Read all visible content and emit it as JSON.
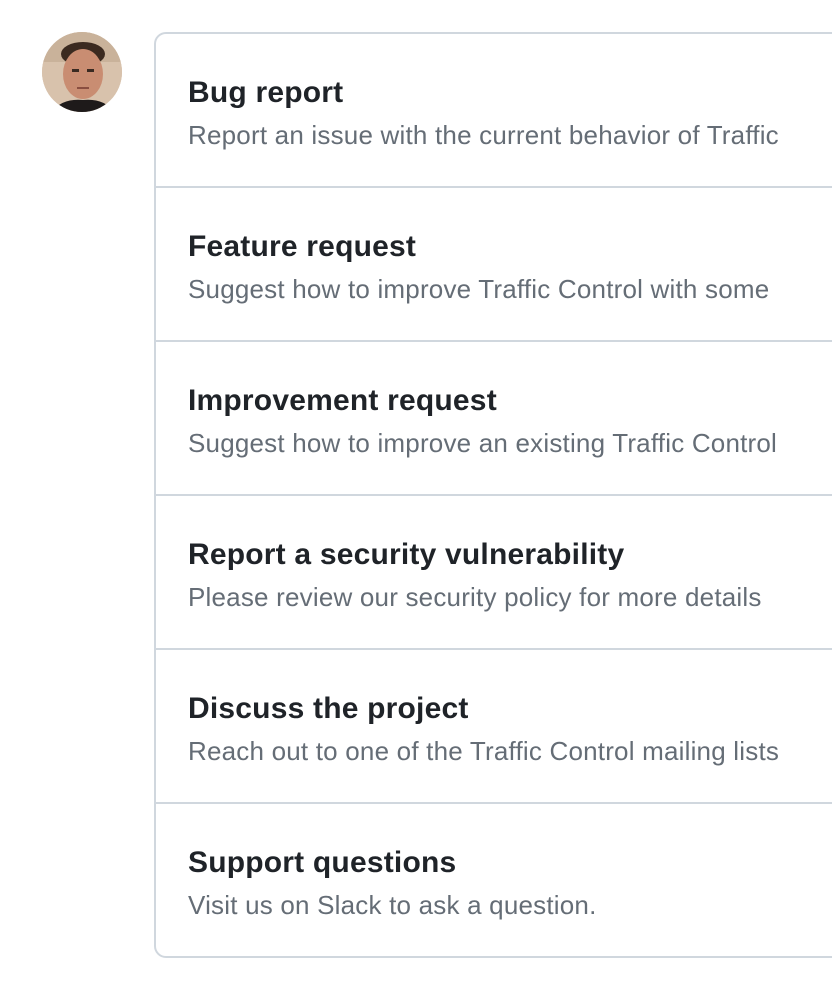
{
  "user": {
    "avatar_icon": "user-avatar-photo"
  },
  "options": [
    {
      "title": "Bug report",
      "description": "Report an issue with the current behavior of Traffic"
    },
    {
      "title": "Feature request",
      "description": "Suggest how to improve Traffic Control with some"
    },
    {
      "title": "Improvement request",
      "description": "Suggest how to improve an existing Traffic Control"
    },
    {
      "title": "Report a security vulnerability",
      "description": "Please review our security policy for more details"
    },
    {
      "title": "Discuss the project",
      "description": "Reach out to one of the Traffic Control mailing lists"
    },
    {
      "title": "Support questions",
      "description": "Visit us on Slack to ask a question."
    }
  ],
  "colors": {
    "border": "#d0d7de",
    "title": "#1f2328",
    "description": "#656d76"
  }
}
